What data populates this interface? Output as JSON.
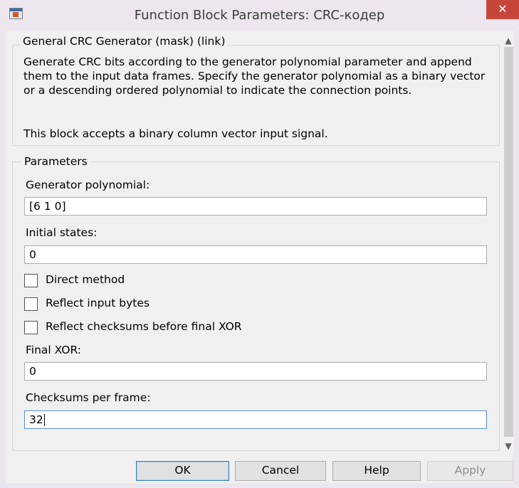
{
  "window": {
    "title": "Function Block Parameters: CRC-кодер",
    "close_label": "✕",
    "icon": "simulink-block-icon"
  },
  "mask_group": {
    "title": "General CRC Generator (mask) (link)",
    "description": "Generate CRC bits according to the generator polynomial parameter and append them to the input data frames. Specify the generator polynomial as a binary vector or a descending ordered polynomial to indicate the connection points.",
    "note": "This block accepts a binary column vector input signal."
  },
  "params_group": {
    "title": "Parameters",
    "generator_polynomial": {
      "label": "Generator polynomial:",
      "value": "[6 1 0]"
    },
    "initial_states": {
      "label": "Initial states:",
      "value": "0"
    },
    "direct_method": {
      "label": "Direct method",
      "checked": false
    },
    "reflect_input_bytes": {
      "label": "Reflect input bytes",
      "checked": false
    },
    "reflect_checksums": {
      "label": "Reflect checksums before final XOR",
      "checked": false
    },
    "final_xor": {
      "label": "Final XOR:",
      "value": "0"
    },
    "checksums_per_frame": {
      "label": "Checksums per frame:",
      "value": "32"
    }
  },
  "scrollbar": {
    "up_icon": "▲",
    "down_icon": "▼"
  },
  "buttons": {
    "ok": "OK",
    "cancel": "Cancel",
    "help": "Help",
    "apply": "Apply"
  },
  "colors": {
    "close_button": "#c7463c",
    "focus_border": "#5b8fd6"
  }
}
